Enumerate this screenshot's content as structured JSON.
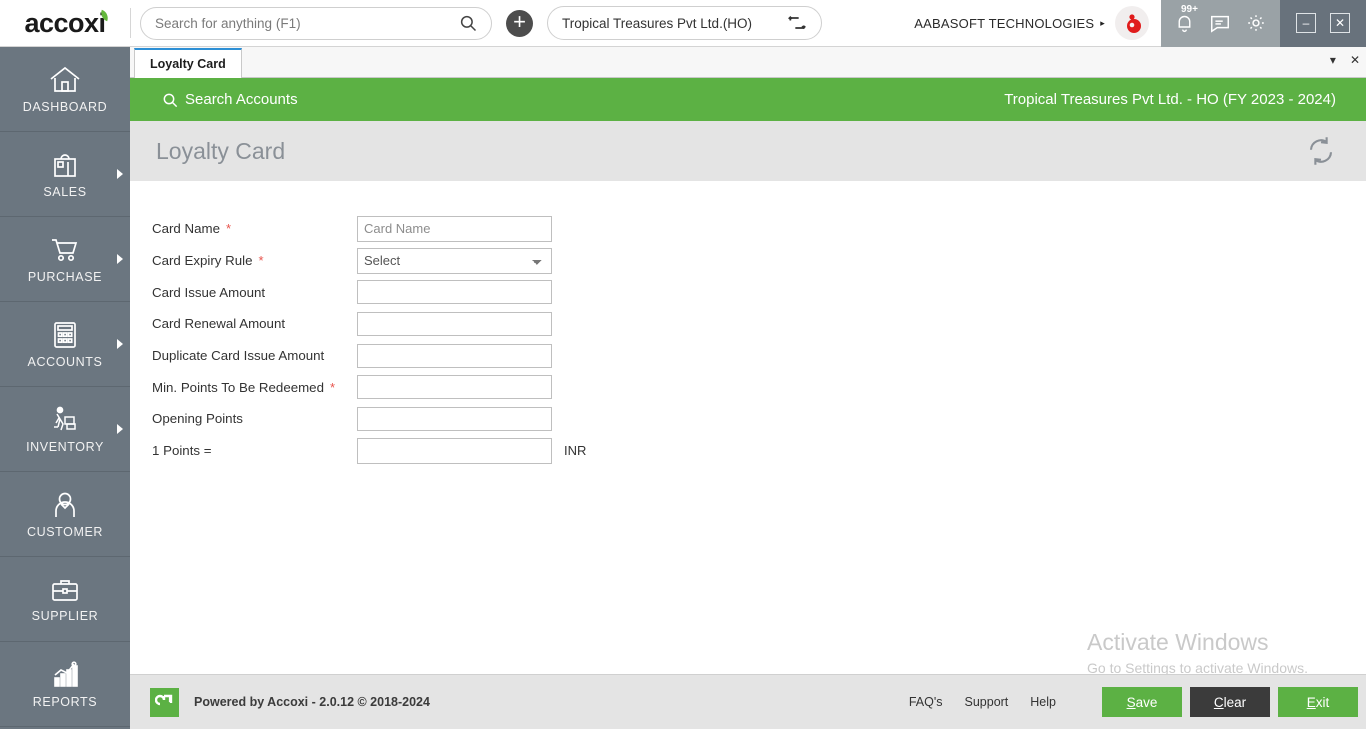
{
  "app": {
    "name": "accoxi",
    "logo_icon": "leaf-icon"
  },
  "topbar": {
    "search": {
      "icon": "search-icon",
      "placeholder": "Search for anything (F1)",
      "value": ""
    },
    "add_button": {
      "icon": "plus-icon",
      "label": "+"
    },
    "branch": {
      "value": "Tropical Treasures Pvt Ltd.(HO)",
      "switch_icon": "switch-branch-icon"
    },
    "user": {
      "name": "AABASOFT TECHNOLOGIES",
      "caret": "▸",
      "avatar_icon": "user-avatar-icon"
    },
    "icons": [
      {
        "name": "notification-bell-icon",
        "badge": "99+"
      },
      {
        "name": "message-note-icon",
        "badge": ""
      },
      {
        "name": "settings-gear-icon",
        "badge": ""
      }
    ],
    "window_controls": [
      {
        "name": "minimize-button",
        "glyph": "–"
      },
      {
        "name": "close-button",
        "glyph": "✕"
      }
    ]
  },
  "sidebar": {
    "items": [
      {
        "label": "DASHBOARD",
        "icon": "home-icon",
        "has_submenu": false
      },
      {
        "label": "SALES",
        "icon": "shopping-bag-icon",
        "has_submenu": true
      },
      {
        "label": "PURCHASE",
        "icon": "shopping-cart-icon",
        "has_submenu": true
      },
      {
        "label": "ACCOUNTS",
        "icon": "calculator-icon",
        "has_submenu": true
      },
      {
        "label": "INVENTORY",
        "icon": "warehouse-worker-icon",
        "has_submenu": true
      },
      {
        "label": "CUSTOMER",
        "icon": "person-icon",
        "has_submenu": false
      },
      {
        "label": "SUPPLIER",
        "icon": "briefcase-icon",
        "has_submenu": false
      },
      {
        "label": "REPORTS",
        "icon": "bar-chart-icon",
        "has_submenu": false
      }
    ]
  },
  "tabbar": {
    "tabs": [
      {
        "label": "Loyalty Card",
        "active": true
      }
    ],
    "dropdown_icon": "chevron-down-icon",
    "close_icon": "close-icon"
  },
  "greenbar": {
    "search_accounts_label": "Search Accounts",
    "search_icon": "search-icon",
    "company_info": "Tropical Treasures Pvt Ltd. - HO (FY 2023 - 2024)"
  },
  "page": {
    "title": "Loyalty Card",
    "refresh_icon": "refresh-icon"
  },
  "form": {
    "fields": [
      {
        "label": "Card Name",
        "required": true,
        "type": "text",
        "placeholder": "Card Name",
        "value": "",
        "suffix": ""
      },
      {
        "label": "Card Expiry Rule",
        "required": true,
        "type": "select",
        "placeholder": "",
        "value": "Select",
        "suffix": ""
      },
      {
        "label": "Card Issue Amount",
        "required": false,
        "type": "text",
        "placeholder": "",
        "value": "",
        "suffix": ""
      },
      {
        "label": "Card Renewal Amount",
        "required": false,
        "type": "text",
        "placeholder": "",
        "value": "",
        "suffix": ""
      },
      {
        "label": "Duplicate Card Issue Amount",
        "required": false,
        "type": "text",
        "placeholder": "",
        "value": "",
        "suffix": ""
      },
      {
        "label": "Min. Points To Be Redeemed",
        "required": true,
        "type": "text",
        "placeholder": "",
        "value": "",
        "suffix": ""
      },
      {
        "label": "Opening Points",
        "required": false,
        "type": "text",
        "placeholder": "",
        "value": "",
        "suffix": ""
      },
      {
        "label": "1 Points  =",
        "required": false,
        "type": "text",
        "placeholder": "",
        "value": "",
        "suffix": "INR"
      }
    ],
    "expiry_rule_options": [
      "Select"
    ]
  },
  "watermark": {
    "line1": "Activate Windows",
    "line2": "Go to Settings to activate Windows."
  },
  "footer": {
    "logo_icon": "accoxi-arrow-icon",
    "powered_by": "Powered by Accoxi - 2.0.12 © 2018-2024",
    "links": [
      {
        "label": "FAQ's"
      },
      {
        "label": "Support"
      },
      {
        "label": "Help"
      }
    ],
    "buttons": [
      {
        "label": "Save",
        "accel": "S",
        "style": "green"
      },
      {
        "label": "Clear",
        "accel": "C",
        "style": "dark"
      },
      {
        "label": "Exit",
        "accel": "E",
        "style": "green"
      }
    ]
  },
  "colors": {
    "brand_green": "#5cb144",
    "sidebar_gray": "#6b7680",
    "iconbar_gray": "#9aa2a6",
    "wincontrol_gray": "#68727c",
    "required_red": "#e8544d",
    "tab_accent_blue": "#2d8fd5"
  }
}
